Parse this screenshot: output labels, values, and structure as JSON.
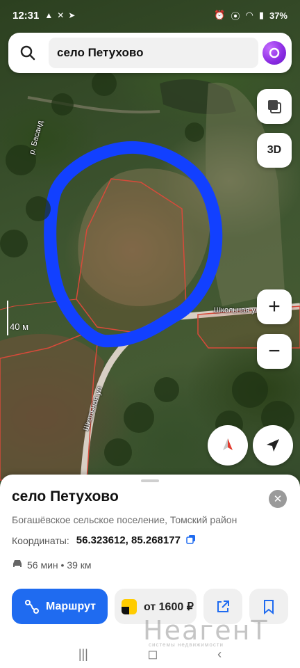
{
  "status_bar": {
    "time": "12:31",
    "battery": "37%"
  },
  "search": {
    "query": "село Петухово"
  },
  "map": {
    "layers_button": "layers-icon",
    "mode_3d": "3D",
    "zoom_in": "+",
    "zoom_out": "−",
    "scale_label": "40 м",
    "street_labels": {
      "school_street_1": "Школьная ул",
      "school_street_2": "Школьная ул",
      "river": "р. Басанд"
    },
    "highlight_color": "#1240ff",
    "parcel_color": "#d84a3a"
  },
  "place": {
    "title": "село Петухово",
    "subtitle": "Богашёвское сельское поселение, Томский район",
    "coords_label": "Координаты:",
    "coords_value": "56.323612, 85.268177",
    "route_info": "56 мин • 39 км"
  },
  "actions": {
    "route_label": "Маршрут",
    "taxi_label": "от 1600 ₽"
  },
  "watermark": {
    "brand": "НеагенТ",
    "tagline": "системы недвижимости"
  },
  "colors": {
    "accent": "#1f6bf0",
    "taxi": "#ffcc00"
  }
}
